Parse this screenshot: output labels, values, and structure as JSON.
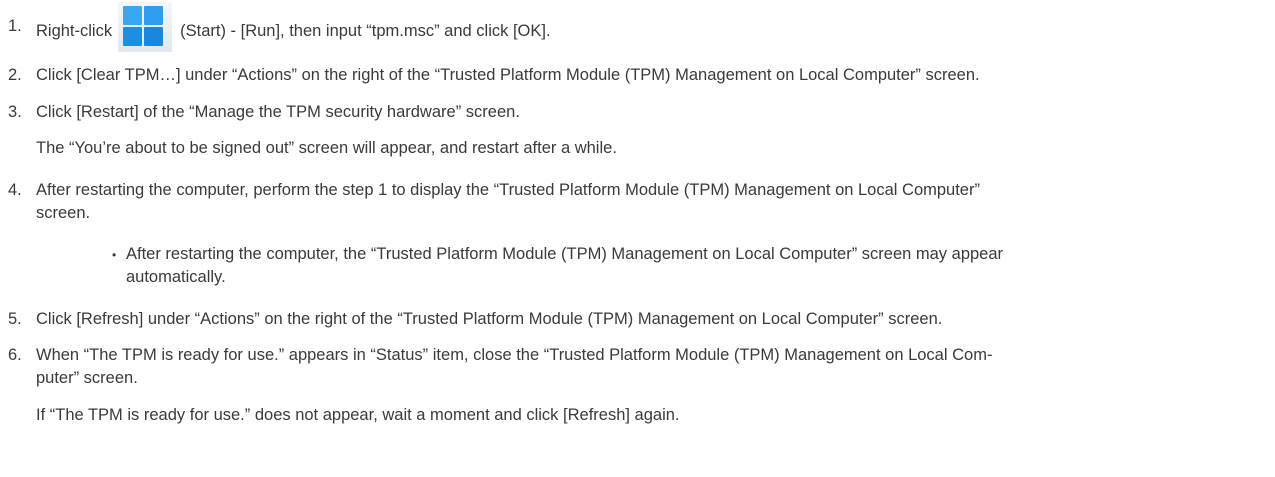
{
  "steps": [
    {
      "number": "1.",
      "text_before_icon": "Right-click",
      "icon": "windows-start-icon",
      "text_after_icon": "(Start) - [Run], then input “tpm.msc” and click [OK]."
    },
    {
      "number": "2.",
      "text": "Click [Clear TPM…] under “Actions” on the right of the “Trusted Platform Module (TPM) Management on Local Computer” screen."
    },
    {
      "number": "3.",
      "text": "Click [Restart] of the “Manage the TPM security hardware” screen.",
      "note": "The “You’re about to be signed out” screen will appear, and restart after a while."
    },
    {
      "number": "4.",
      "text_line1": "After restarting the computer, perform the step 1 to display the “Trusted Platform Module (TPM) Management on Local Computer”",
      "text_line2": "screen.",
      "bullet_line1": "After restarting the computer, the “Trusted Platform Module (TPM) Management on Local Computer” screen may appear",
      "bullet_line2": "automatically."
    },
    {
      "number": "5.",
      "text": "Click [Refresh] under “Actions” on the right of the “Trusted Platform Module (TPM) Management on Local Computer” screen."
    },
    {
      "number": "6.",
      "text_line1": "When “The TPM is ready for use.” appears in “Status” item, close the “Trusted Platform Module (TPM) Management on Local Com-",
      "text_line2": "puter” screen.",
      "note": "If “The TPM is ready for use.” does not appear, wait a moment and click [Refresh] again."
    }
  ],
  "colors": {
    "text": "#3a3a3a",
    "icon_blue": "#1a8fe3",
    "icon_blue_light": "#3aa8f0"
  }
}
